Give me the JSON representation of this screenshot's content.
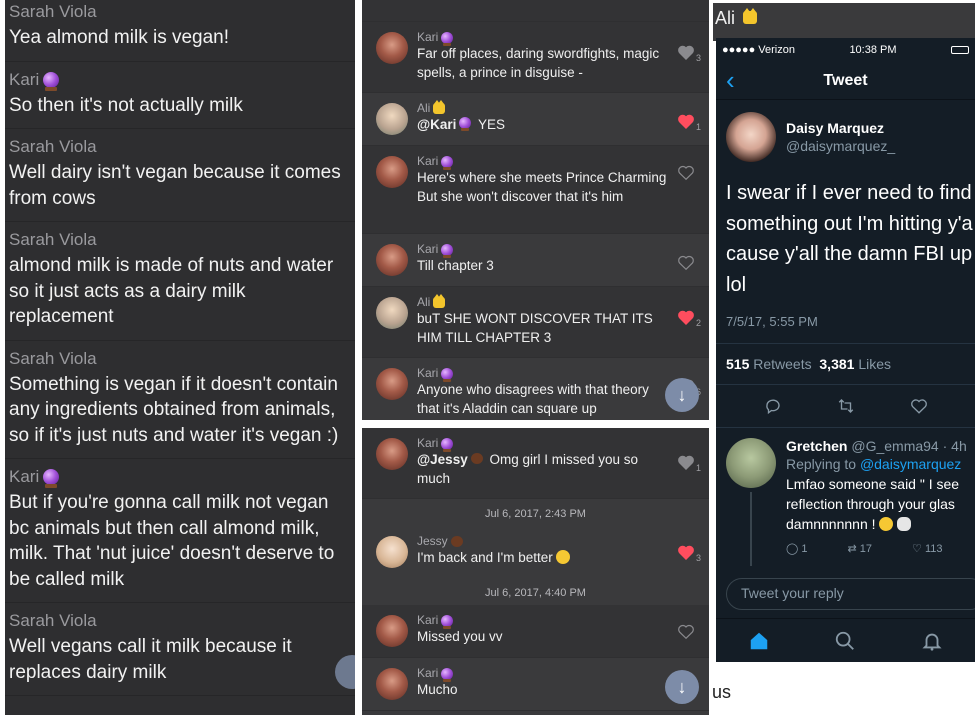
{
  "left": {
    "messages": [
      {
        "sender": "Sarah Viola",
        "text": "Yea almond milk is vegan!"
      },
      {
        "sender": "Kari",
        "text": "So then it's not actually milk"
      },
      {
        "sender": "Sarah Viola",
        "text": "Well dairy isn't vegan because it comes from cows"
      },
      {
        "sender": "Sarah Viola",
        "text": "almond milk is made of nuts and water so it just acts as a dairy milk replacement"
      },
      {
        "sender": "Sarah Viola",
        "text": "Something is vegan if it doesn't contain any ingredients obtained from animals, so if it's just nuts and water it's vegan :)"
      },
      {
        "sender": "Kari",
        "text": "But if you're gonna call milk not vegan bc animals but then call almond milk, milk. That 'nut juice' doesn't deserve to be called milk"
      },
      {
        "sender": "Sarah Viola",
        "text": "Well vegans call it milk because it replaces dairy milk"
      }
    ]
  },
  "mid_top": {
    "rows": [
      {
        "name": "Kari",
        "text": "Far off places, daring swordfights, magic spells, a prince in disguise -",
        "likes": "3",
        "liked": false
      },
      {
        "name": "Ali",
        "mention": "@Kari",
        "text": " YES",
        "likes": "1",
        "liked": true
      },
      {
        "name": "Kari",
        "text": "Here's where she meets Prince Charming\nBut she won't discover that it's him",
        "likes": "",
        "liked": false
      },
      {
        "name": "Kari",
        "text": "Till chapter 3",
        "likes": "",
        "liked": false
      },
      {
        "name": "Ali",
        "text": "buT SHE WONT DISCOVER THAT ITS HIM TILL CHAPTER 3",
        "likes": "2",
        "liked": true
      },
      {
        "name": "Kari",
        "text": "Anyone who disagrees with that theory that it's Aladdin can square up",
        "likes": "6",
        "liked": false
      }
    ],
    "scroll_icon": "arrow-down-icon"
  },
  "mid_bottom": {
    "row1": {
      "name": "Kari",
      "mention": "@Jessy",
      "text": " Omg girl I missed you so much",
      "likes": "1"
    },
    "date1": "Jul 6, 2017, 2:43 PM",
    "row2": {
      "name": "Jessy",
      "text": "I'm back and I'm better",
      "likes": "3"
    },
    "date2": "Jul 6, 2017, 4:40 PM",
    "row3": {
      "name": "Kari",
      "text": "Missed you vv"
    },
    "row4": {
      "name": "Kari",
      "text": "Mucho"
    }
  },
  "right": {
    "header_label": "Ali",
    "status": {
      "carrier": "●●●●● Verizon",
      "time": "10:38 PM"
    },
    "nav_title": "Tweet",
    "author": {
      "name": "Daisy Marquez",
      "handle": "@daisymarquez_"
    },
    "tweet_lines": [
      "I swear if I ever need to find",
      "something out I'm hitting y'a",
      "cause y'all the damn FBI up",
      "lol"
    ],
    "time": "7/5/17, 5:55 PM",
    "retweets": "515",
    "retweets_label": "Retweets",
    "likes": "3,381",
    "likes_label": "Likes",
    "reply": {
      "name": "Gretchen",
      "handle": "@G_emma94 · 4h",
      "replying_label": "Replying to",
      "replying_handle": "@daisymarquez",
      "lines": [
        "Lmfao someone said \" I see",
        "reflection through your glas",
        "damnnnnnnn !"
      ],
      "reply_count": "1",
      "rt_count": "17",
      "like_count": "113"
    },
    "reply_placeholder": "Tweet your reply",
    "below_text": "us"
  },
  "colors": {
    "twitter_blue": "#1da1f2",
    "heart_red": "#ff4d5e",
    "panel_dark": "#2e2e30",
    "twitter_bg": "#141d26"
  }
}
